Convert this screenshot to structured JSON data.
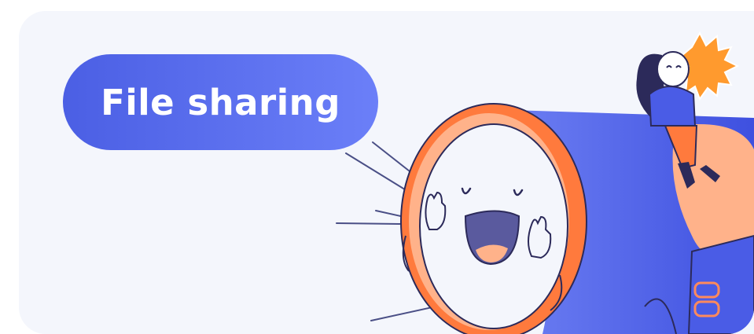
{
  "banner": {
    "title": "File sharing",
    "colors": {
      "background": "#f4f6fc",
      "pill_start": "#4b5fe4",
      "pill_end": "#6b7ff8",
      "megaphone_blue": "#4a5ce6",
      "ring_orange": "#ff7a3d",
      "ring_peach": "#ffb28a",
      "outline": "#2c2a5a"
    },
    "illustration": {
      "main_icon": "megaphone-icon",
      "character_icon": "girl-shouting-icon",
      "burst_icon": "sound-burst-icon"
    }
  }
}
